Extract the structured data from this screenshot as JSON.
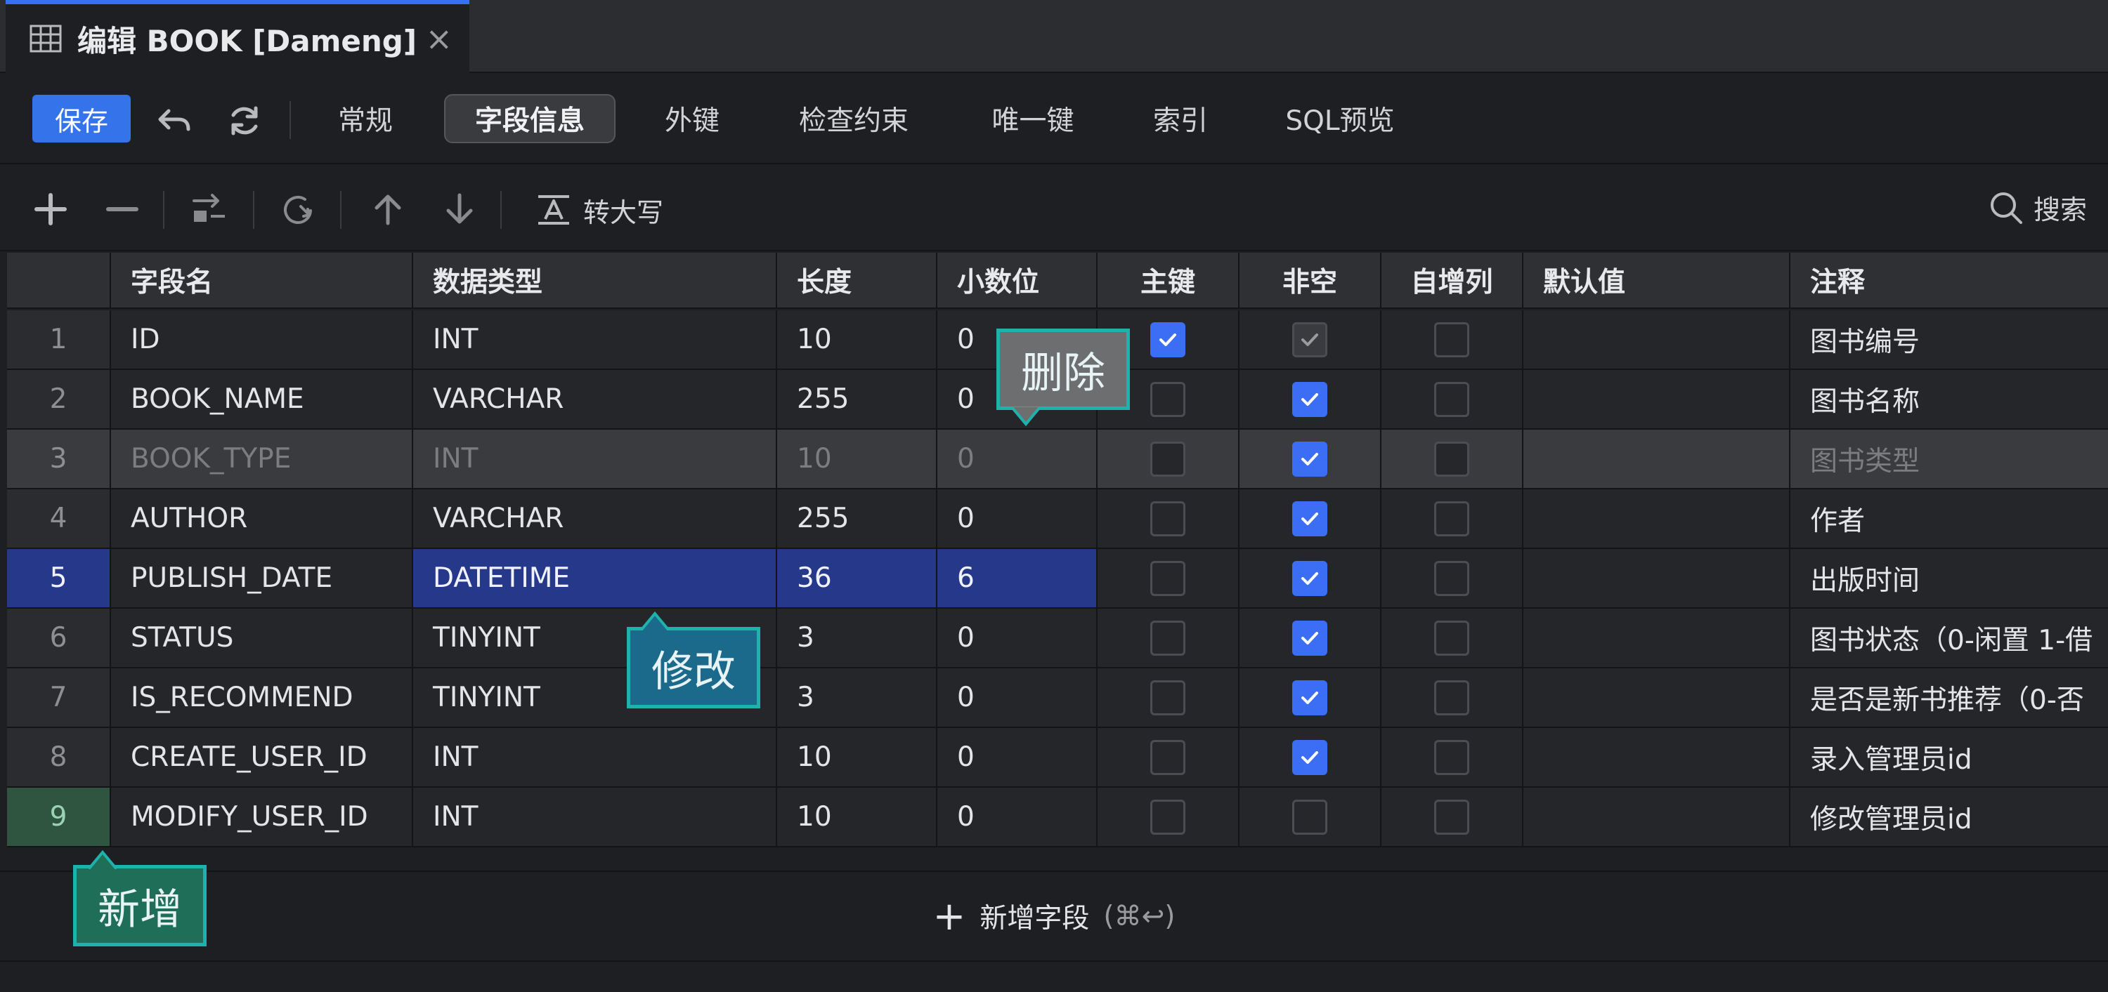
{
  "window_tab": {
    "title": "编辑 BOOK [Dameng]",
    "close": "×"
  },
  "toolbar": {
    "save_label": "保存",
    "tabs": [
      {
        "label": "常规",
        "active": false
      },
      {
        "label": "字段信息",
        "active": true
      },
      {
        "label": "外键",
        "active": false
      },
      {
        "label": "检查约束",
        "active": false
      },
      {
        "label": "唯一键",
        "active": false
      },
      {
        "label": "索引",
        "active": false
      },
      {
        "label": "SQL预览",
        "active": false
      }
    ]
  },
  "field_toolbar": {
    "uppercase_label": "转大写",
    "search_label": "搜索"
  },
  "table": {
    "columns": [
      "字段名",
      "数据类型",
      "长度",
      "小数位",
      "主键",
      "非空",
      "自增列",
      "默认值",
      "注释"
    ],
    "rows": [
      {
        "num": "1",
        "name": "ID",
        "type": "INT",
        "length": "10",
        "scale": "0",
        "pk": true,
        "notnull": true,
        "notnull_locked": true,
        "auto": false,
        "default": "",
        "comment": "图书编号"
      },
      {
        "num": "2",
        "name": "BOOK_NAME",
        "type": "VARCHAR",
        "length": "255",
        "scale": "0",
        "pk": false,
        "notnull": true,
        "auto": false,
        "default": "",
        "comment": "图书名称"
      },
      {
        "num": "3",
        "name": "BOOK_TYPE",
        "type": "INT",
        "length": "10",
        "scale": "0",
        "pk": false,
        "notnull": true,
        "auto": false,
        "default": "",
        "comment": "图书类型",
        "state": "deleted"
      },
      {
        "num": "4",
        "name": "AUTHOR",
        "type": "VARCHAR",
        "length": "255",
        "scale": "0",
        "pk": false,
        "notnull": true,
        "auto": false,
        "default": "",
        "comment": "作者"
      },
      {
        "num": "5",
        "name": "PUBLISH_DATE",
        "type": "DATETIME",
        "length": "36",
        "scale": "6",
        "pk": false,
        "notnull": true,
        "auto": false,
        "default": "",
        "comment": "出版时间",
        "state": "modified"
      },
      {
        "num": "6",
        "name": "STATUS",
        "type": "TINYINT",
        "length": "3",
        "scale": "0",
        "pk": false,
        "notnull": true,
        "auto": false,
        "default": "",
        "comment": "图书状态（0-闲置 1-借"
      },
      {
        "num": "7",
        "name": "IS_RECOMMEND",
        "type": "TINYINT",
        "length": "3",
        "scale": "0",
        "pk": false,
        "notnull": true,
        "auto": false,
        "default": "",
        "comment": "是否是新书推荐（0-否"
      },
      {
        "num": "8",
        "name": "CREATE_USER_ID",
        "type": "INT",
        "length": "10",
        "scale": "0",
        "pk": false,
        "notnull": true,
        "auto": false,
        "default": "",
        "comment": "录入管理员id"
      },
      {
        "num": "9",
        "name": "MODIFY_USER_ID",
        "type": "INT",
        "length": "10",
        "scale": "0",
        "pk": false,
        "notnull": false,
        "auto": false,
        "default": "",
        "comment": "修改管理员id",
        "state": "new"
      }
    ]
  },
  "add_field": {
    "label": "新增字段",
    "shortcut": "(⌘↩)"
  },
  "callouts": {
    "delete": "删除",
    "modify": "修改",
    "add": "新增"
  },
  "colors": {
    "accent": "#3c6ef5",
    "callout_border": "#1fb2ad",
    "selection": "#26388a"
  }
}
